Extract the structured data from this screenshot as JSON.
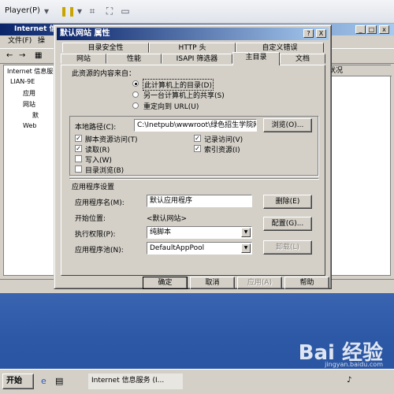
{
  "vm": {
    "player_label": "Player(P)"
  },
  "bgwindow": {
    "title": "Internet 信",
    "menu": [
      "文件(F)",
      "操"
    ],
    "tree": [
      "Internet 信息服务",
      "LIAN-9E",
      "应用",
      "网站",
      "默",
      "Web"
    ],
    "list_header": "状况"
  },
  "dialog": {
    "title": "默认网站 属性",
    "help": "?",
    "close": "X",
    "tabs_back": [
      "目录安全性",
      "HTTP 头",
      "自定义错误"
    ],
    "tabs_front": [
      "网站",
      "性能",
      "ISAPI 筛选器",
      "主目录",
      "文档"
    ],
    "active_tab": "主目录",
    "source_label": "此资源的内容来自：",
    "radio_options": [
      "此计算机上的目录(D)",
      "另一台计算机上的共享(S)",
      "重定向到 URL(U)"
    ],
    "path_label": "本地路径(C):",
    "path_value": "C:\\Inetpub\\wwwroot\\绿色招生学院网",
    "browse_button": "浏览(O)...",
    "checks": [
      {
        "label": "脚本资源访问(T)",
        "checked": true
      },
      {
        "label": "读取(R)",
        "checked": true
      },
      {
        "label": "写入(W)",
        "checked": false
      },
      {
        "label": "目录浏览(B)",
        "checked": false
      },
      {
        "label": "记录访问(V)",
        "checked": true
      },
      {
        "label": "索引资源(I)",
        "checked": true
      }
    ],
    "app_settings_label": "应用程序设置",
    "app_name_label": "应用程序名(M):",
    "app_name_value": "默认应用程序",
    "remove_button": "删除(E)",
    "start_point_label": "开始位置:",
    "start_point_value": "<默认网站>",
    "config_button": "配置(G)...",
    "exec_label": "执行权限(P):",
    "exec_value": "纯脚本",
    "pool_label": "应用程序池(N):",
    "pool_value": "DefaultAppPool",
    "unload_button": "卸载(L)",
    "ok_button": "确定",
    "cancel_button": "取消",
    "apply_button": "应用(A)",
    "help_button": "帮助"
  },
  "taskbar": {
    "start_label": "开始",
    "task_label": "Internet 信息服务 (I..."
  },
  "watermark": {
    "brand": "Bai 经验",
    "url": "jingyan.baidu.com"
  },
  "colors": {
    "titlebar": "#0a246a",
    "face": "#d4d0c8",
    "desktop": "#2c58a6"
  }
}
